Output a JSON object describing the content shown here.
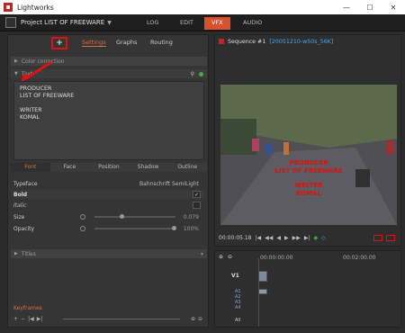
{
  "os": {
    "title": "Lightworks",
    "minimize": "—",
    "maximize": "☐",
    "close": "✕"
  },
  "menubar": {
    "project": "Project LIST OF FREEWARE",
    "tabs": [
      "LOG",
      "EDIT",
      "VFX",
      "AUDIO"
    ],
    "active_tab": "VFX"
  },
  "left_panel": {
    "plus_label": "+",
    "tabs": [
      "Settings",
      "Graphs",
      "Routing"
    ],
    "section_top": "Color correction",
    "effect_name": "Text",
    "text_lines": [
      "PRODUCER",
      "LIST OF FREEWARE",
      "",
      "WRITER",
      "KOMAL"
    ],
    "font_tabs": [
      "Font",
      "Face",
      "Position",
      "Shadow",
      "Outline"
    ],
    "typeface_label": "Typeface",
    "typeface_value": "Bahnschrift SemiLight",
    "bold_label": "Bold",
    "bold_check": "✓",
    "italic_label": "Italic",
    "size_label": "Size",
    "size_value": "0.079",
    "opacity_label": "Opacity",
    "opacity_value": "100%",
    "titles_section": "Titles",
    "keyframes_label": "Keyframes"
  },
  "viewer": {
    "sequence": "Sequence #1",
    "clip": "[20051210-w50s_56K]",
    "overlay_line1": "PRODUCER",
    "overlay_line2": "LIST OF FREEWARE",
    "overlay_line3": "WRITER",
    "overlay_line4": "KOMAL",
    "timecode": "00:00:05.18",
    "controls": [
      "|◀",
      "◀◀",
      "◀",
      "▶",
      "▶▶",
      "▶|"
    ]
  },
  "timeline": {
    "ruler_1": "00:00:00.00",
    "ruler_2": "00:02:00.00",
    "tracks": [
      "V1",
      "A1",
      "A2",
      "A3",
      "A4",
      "All"
    ]
  }
}
